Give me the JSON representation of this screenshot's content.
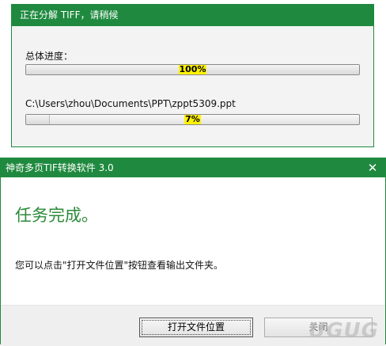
{
  "progress_dialog": {
    "title": "正在分解 TIFF，请稍候",
    "overall_label": "总体进度：",
    "overall_percent": "100%",
    "overall_value": 1.0,
    "file_path": "C:\\Users\\zhou\\Documents\\PPT\\zppt5309.ppt",
    "file_percent": "7%",
    "file_value": 0.07
  },
  "complete_dialog": {
    "title": "神奇多页TIF转换软件 3.0",
    "close_glyph": "✕",
    "heading": "任务完成。",
    "message": "您可以点击\"打开文件位置\"按钮查看输出文件夹。",
    "open_location_button": "打开文件位置",
    "close_button": "关闭"
  },
  "watermark": "UGUG"
}
